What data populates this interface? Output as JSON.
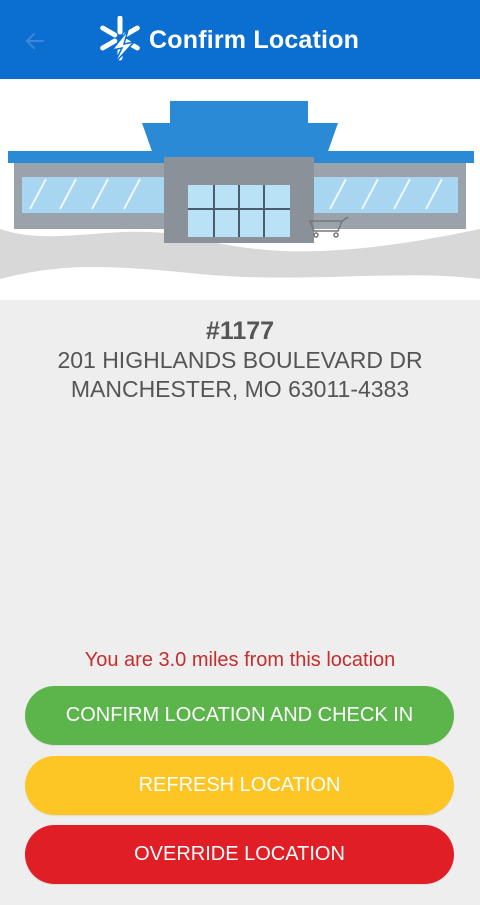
{
  "header": {
    "title": "Confirm Location",
    "back_icon": "arrow-left-icon",
    "logo_icon": "spark-logo-icon",
    "color": "#0a6fd0"
  },
  "store": {
    "number": "#1177",
    "address_line1": "201 HIGHLANDS BOULEVARD DR",
    "address_line2": "MANCHESTER, MO 63011-4383"
  },
  "distance_text": "You are 3.0 miles from this location",
  "buttons": {
    "confirm": "CONFIRM LOCATION AND CHECK IN",
    "refresh": "REFRESH LOCATION",
    "override": "OVERRIDE LOCATION"
  },
  "colors": {
    "confirm": "#5bb54a",
    "refresh": "#fdc624",
    "override": "#e01e26",
    "distance": "#c62d2d"
  }
}
